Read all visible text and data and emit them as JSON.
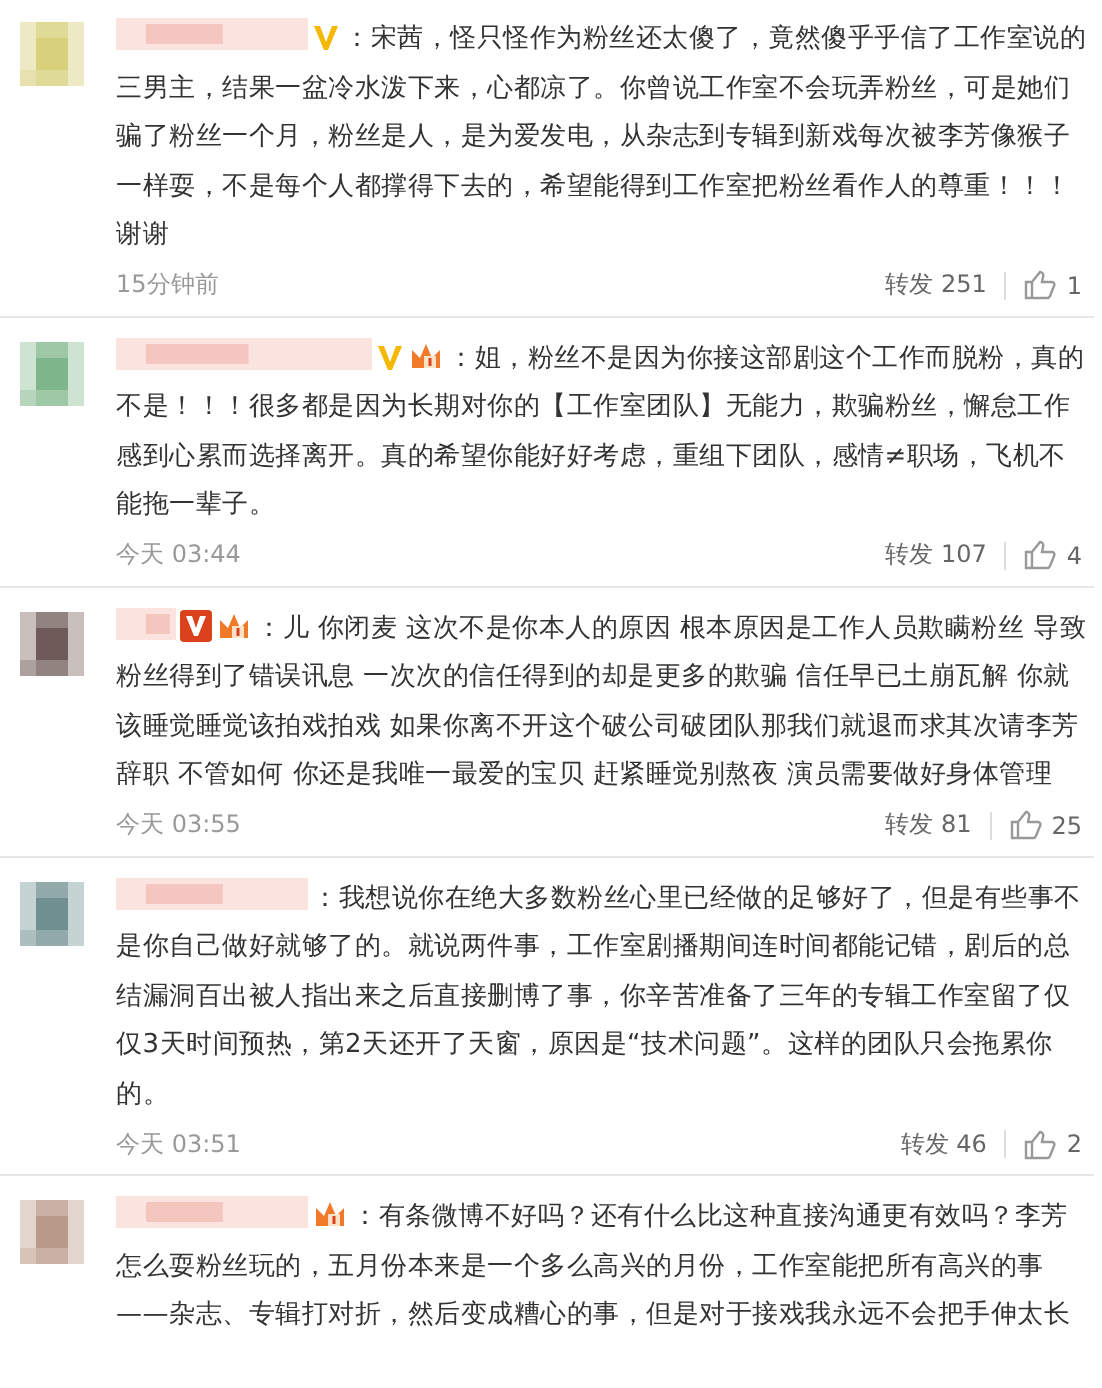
{
  "comments": [
    {
      "badges": [
        {
          "kind": "v_gold"
        }
      ],
      "text": "：宋茜，怪只怪作为粉丝还太傻了，竟然傻乎乎信了工作室说的三男主，结果一盆冷水泼下来，心都凉了。你曾说工作室不会玩弄粉丝，可是她们骗了粉丝一个月，粉丝是人，是为爱发电，从杂志到专辑到新戏每次被李芳像猴子一样耍，不是每个人都撑得下去的，希望能得到工作室把粉丝看作人的尊重！！！谢谢",
      "time": "15分钟前",
      "repost": "转发 251",
      "likes": "1"
    },
    {
      "badges": [
        {
          "kind": "v_gold"
        },
        {
          "kind": "vip"
        }
      ],
      "text": "：姐，粉丝不是因为你接这部剧这个工作而脱粉，真的不是！！！很多都是因为长期对你的【工作室团队】无能力，欺骗粉丝，懈怠工作感到心累而选择离开。真的希望你能好好考虑，重组下团队，感情≠职场，飞机不能拖一辈子。",
      "time": "今天 03:44",
      "repost": "转发 107",
      "likes": "4"
    },
    {
      "badges": [
        {
          "kind": "v_red"
        },
        {
          "kind": "vip"
        }
      ],
      "text": "：儿 你闭麦 这次不是你本人的原因 根本原因是工作人员欺瞒粉丝 导致粉丝得到了错误讯息 一次次的信任得到的却是更多的欺骗 信任早已土崩瓦解 你就该睡觉睡觉该拍戏拍戏 如果你离不开这个破公司破团队那我们就退而求其次请李芳辞职 不管如何 你还是我唯一最爱的宝贝 赶紧睡觉别熬夜 演员需要做好身体管理",
      "time": "今天 03:55",
      "repost": "转发 81",
      "likes": "25"
    },
    {
      "text": "：我想说你在绝大多数粉丝心里已经做的足够好了，但是有些事不是你自己做好就够了的。就说两件事，工作室剧播期间连时间都能记错，剧后的总结漏洞百出被人指出来之后直接删博了事，你辛苦准备了三年的专辑工作室留了仅仅3天时间预热，第2天还开了天窗，原因是“技术问题”。这样的团队只会拖累你的。",
      "time": "今天 03:51",
      "repost": "转发 46",
      "likes": "2"
    },
    {
      "badges": [
        {
          "kind": "vip"
        }
      ],
      "text": "：有条微博不好吗？还有什么比这种直接沟通更有效吗？李芳怎么耍粉丝玩的，五月份本来是一个多么高兴的月份，工作室能把所有高兴的事——杂志、专辑打对折，然后变成糟心的事，但是对于接戏我永远不会把手伸太长"
    }
  ]
}
